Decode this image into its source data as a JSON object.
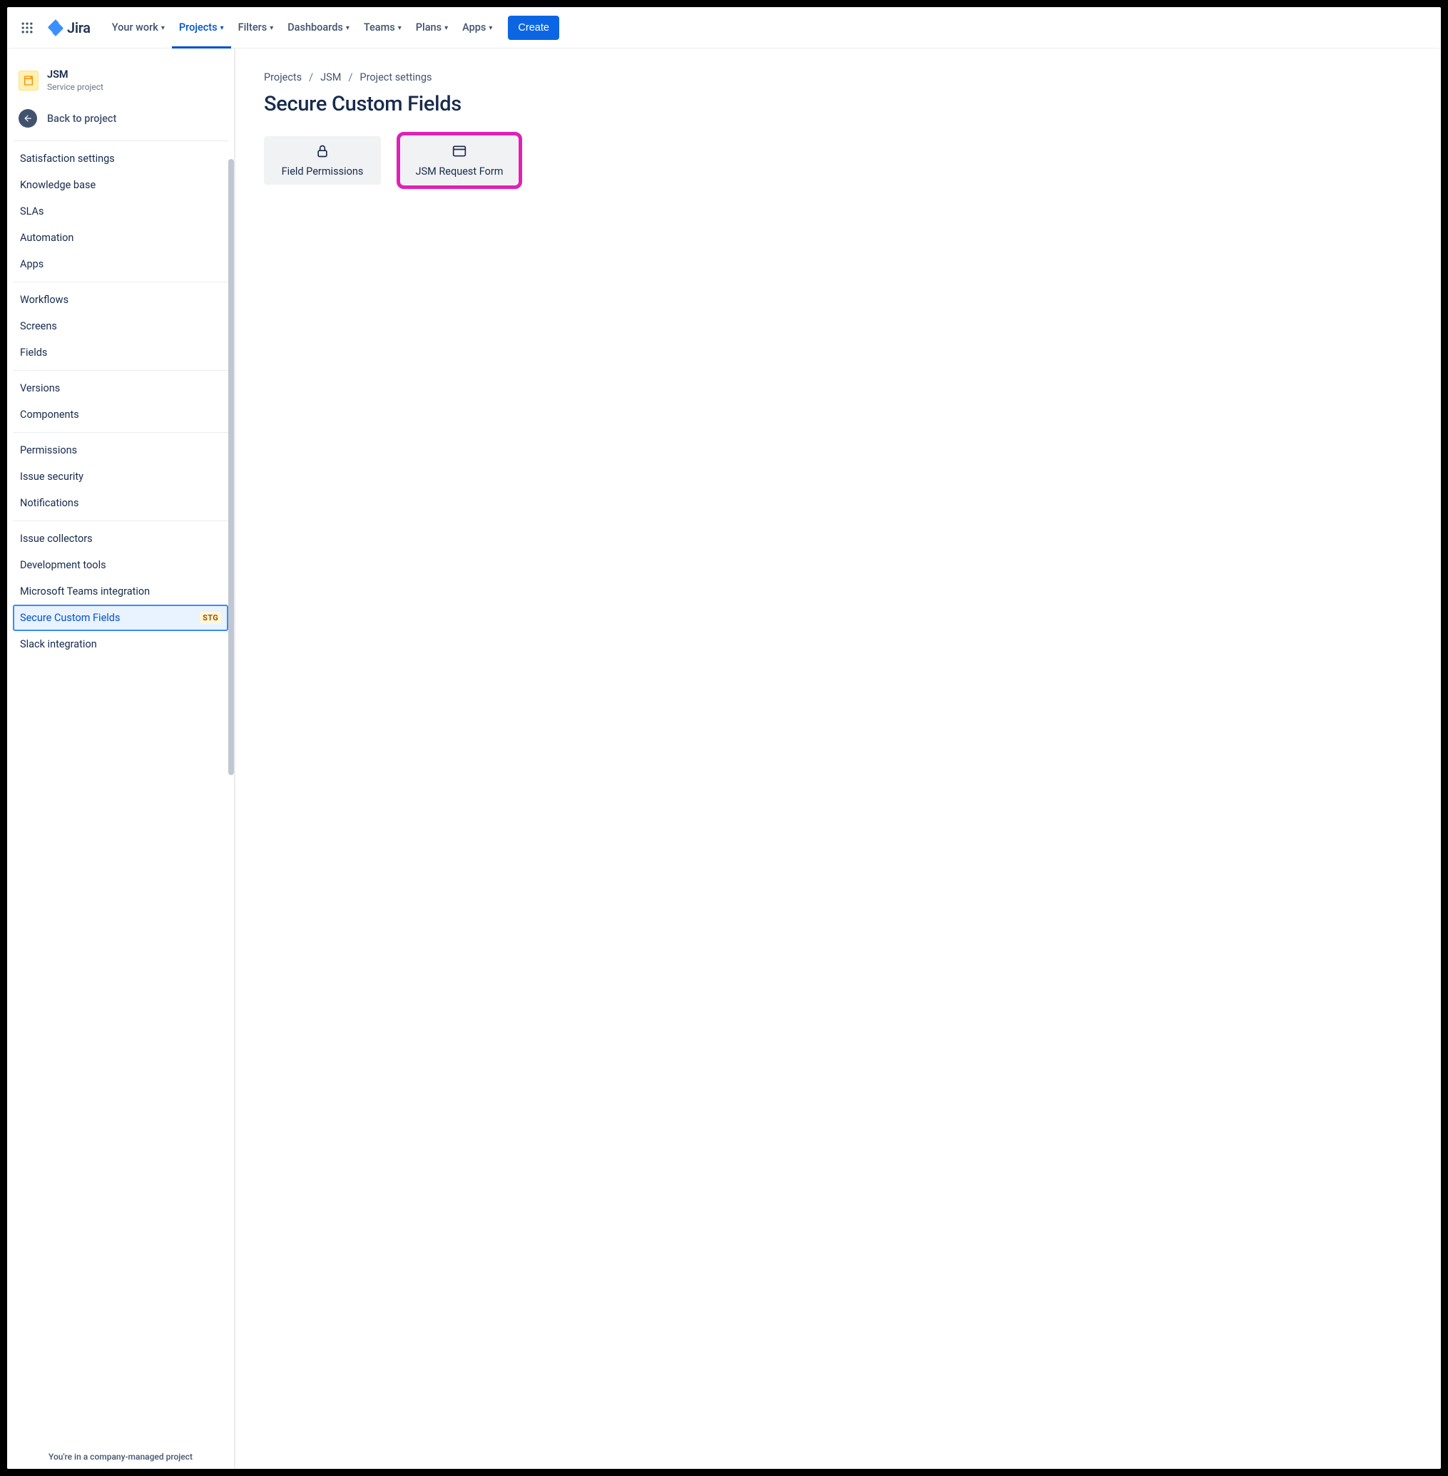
{
  "brand": "Jira",
  "nav": {
    "items": [
      {
        "label": "Your work"
      },
      {
        "label": "Projects",
        "active": true
      },
      {
        "label": "Filters"
      },
      {
        "label": "Dashboards"
      },
      {
        "label": "Teams"
      },
      {
        "label": "Plans"
      },
      {
        "label": "Apps"
      }
    ],
    "create": "Create"
  },
  "project": {
    "name": "JSM",
    "subtitle": "Service project",
    "back_label": "Back to project"
  },
  "sidebar": {
    "sections": [
      [
        "Satisfaction settings",
        "Knowledge base",
        "SLAs",
        "Automation",
        "Apps"
      ],
      [
        "Workflows",
        "Screens",
        "Fields"
      ],
      [
        "Versions",
        "Components"
      ],
      [
        "Permissions",
        "Issue security",
        "Notifications"
      ],
      [
        "Issue collectors",
        "Development tools",
        "Microsoft Teams integration",
        "Secure Custom Fields",
        "Slack integration"
      ]
    ],
    "selected": "Secure Custom Fields",
    "badge": "STG",
    "footer": "You're in a company-managed project"
  },
  "breadcrumb": [
    "Projects",
    "JSM",
    "Project settings"
  ],
  "page_title": "Secure Custom Fields",
  "cards": [
    {
      "label": "Field Permissions",
      "icon": "lock",
      "highlight": false
    },
    {
      "label": "JSM Request Form",
      "icon": "form",
      "highlight": true
    }
  ]
}
